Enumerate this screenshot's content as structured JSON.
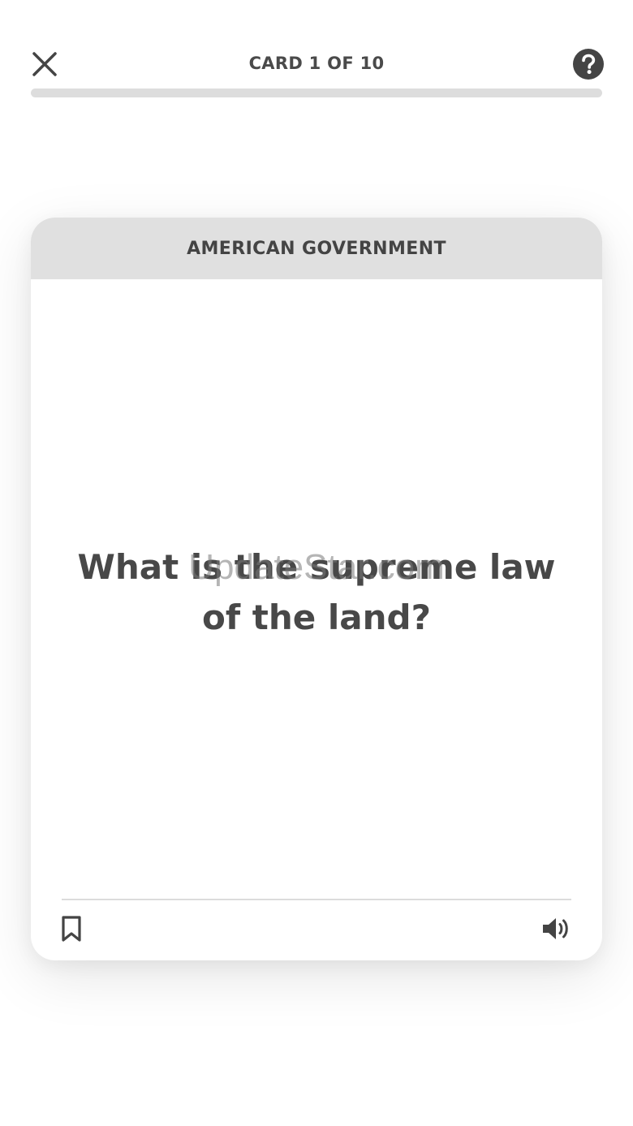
{
  "header": {
    "title": "CARD 1 OF 10",
    "close_icon": "close-icon",
    "help_icon": "help-circle-icon"
  },
  "progress": {
    "current": 1,
    "total": 10,
    "fraction": 0
  },
  "card": {
    "category": "AMERICAN GOVERNMENT",
    "question": "What is the supreme law of the land?",
    "bookmark_icon": "bookmark-icon",
    "audio_icon": "speaker-icon"
  },
  "watermark": "UpdateStar.com",
  "colors": {
    "text": "#484848",
    "header_bg": "#e0e0e0",
    "progress_track": "#dddddd",
    "icon": "#444444"
  }
}
